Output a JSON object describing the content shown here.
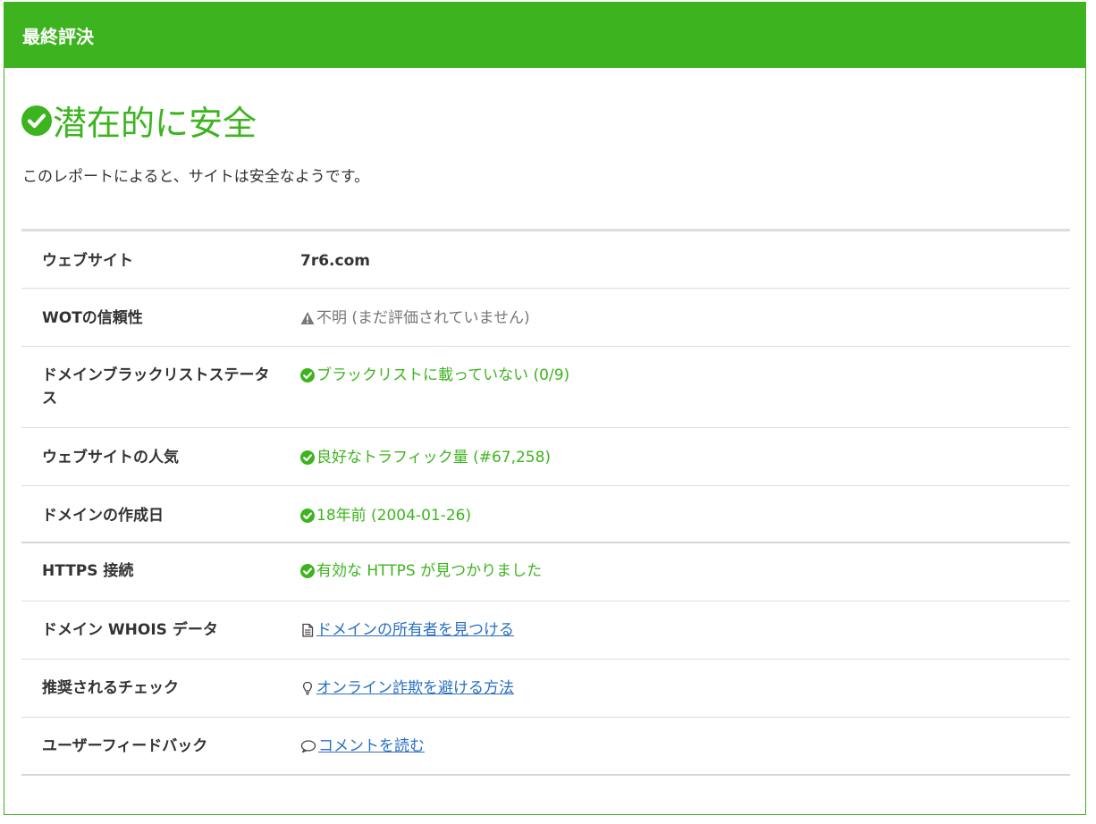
{
  "header": {
    "title": "最終評決"
  },
  "verdict": {
    "text": "潜在的に安全",
    "icon": "check-circle-icon"
  },
  "summary": "このレポートによると、サイトは安全なようです。",
  "colors": {
    "accent": "#3db41f",
    "link": "#2a70c2",
    "muted": "#777777"
  },
  "rows": [
    {
      "label": "ウェブサイト",
      "value": "7r6.com",
      "style": "dark",
      "icon": ""
    },
    {
      "label": "WOTの信頼性",
      "value": "不明 (まだ評価されていません)",
      "style": "gray",
      "icon": "warning-icon"
    },
    {
      "label": "ドメインブラックリストステータス",
      "value": "ブラックリストに載っていない (0/9)",
      "style": "green",
      "icon": "check-circle-icon"
    },
    {
      "label": "ウェブサイトの人気",
      "value": "良好なトラフィック量 (#67,258)",
      "style": "green",
      "icon": "check-circle-icon"
    },
    {
      "label": "ドメインの作成日",
      "value": "18年前 (2004-01-26)",
      "style": "green",
      "icon": "check-circle-icon"
    },
    {
      "label": "HTTPS 接続",
      "value": "有効な HTTPS が見つかりました",
      "style": "green",
      "icon": "check-circle-icon"
    },
    {
      "label": "ドメイン WHOIS データ",
      "value": "ドメインの所有者を見つける",
      "style": "link",
      "icon": "document-icon"
    },
    {
      "label": "推奨されるチェック",
      "value": "オンライン詐欺を避ける方法",
      "style": "link",
      "icon": "lightbulb-icon"
    },
    {
      "label": "ユーザーフィードバック",
      "value": "コメントを読む",
      "style": "link",
      "icon": "comment-icon"
    }
  ]
}
